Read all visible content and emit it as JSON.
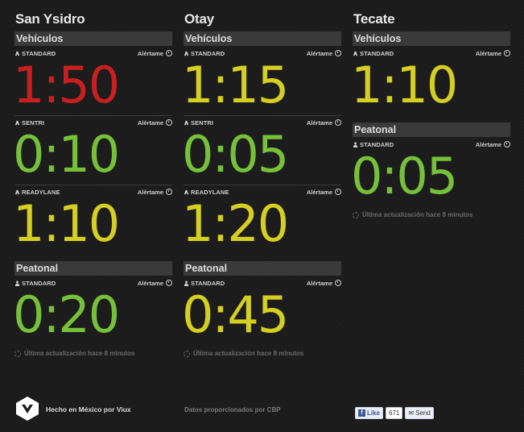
{
  "columns": [
    {
      "crossing": "San Ysidro",
      "sections": [
        {
          "title": "Vehículos",
          "lanes": [
            {
              "type": "STANDARD",
              "icon": "car-icon",
              "time": "1:50",
              "status": "red"
            },
            {
              "type": "SENTRI",
              "icon": "car-icon",
              "time": "0:10",
              "status": "green"
            },
            {
              "type": "READYLANE",
              "icon": "car-icon",
              "time": "1:10",
              "status": "yellow"
            }
          ]
        },
        {
          "title": "Peatonal",
          "lanes": [
            {
              "type": "STANDARD",
              "icon": "person-icon",
              "time": "0:20",
              "status": "green"
            }
          ]
        }
      ],
      "update": "Última actualización hace 8 minutos"
    },
    {
      "crossing": "Otay",
      "sections": [
        {
          "title": "Vehículos",
          "lanes": [
            {
              "type": "STANDARD",
              "icon": "car-icon",
              "time": "1:15",
              "status": "yellow"
            },
            {
              "type": "SENTRI",
              "icon": "car-icon",
              "time": "0:05",
              "status": "green"
            },
            {
              "type": "READYLANE",
              "icon": "car-icon",
              "time": "1:20",
              "status": "yellow"
            }
          ]
        },
        {
          "title": "Peatonal",
          "lanes": [
            {
              "type": "STANDARD",
              "icon": "person-icon",
              "time": "0:45",
              "status": "yellow"
            }
          ]
        }
      ],
      "update": "Última actualización hace 8 minutos"
    },
    {
      "crossing": "Tecate",
      "sections": [
        {
          "title": "Vehículos",
          "lanes": [
            {
              "type": "STANDARD",
              "icon": "car-icon",
              "time": "1:10",
              "status": "yellow"
            }
          ]
        },
        {
          "title": "Peatonal",
          "lanes": [
            {
              "type": "STANDARD",
              "icon": "person-icon",
              "time": "0:05",
              "status": "green"
            }
          ]
        }
      ],
      "update": "Última actualización hace 8 minutos"
    }
  ],
  "alert_label": "Alértame",
  "colors": {
    "red": "#c8201f",
    "green": "#76c03a",
    "yellow": "#d4cf22"
  },
  "footer": {
    "made_by": "Hecho en México por Viux",
    "data_source": "Datos proporcionados por CBP",
    "fb_like": "Like",
    "fb_count": "671",
    "fb_send": "Send"
  }
}
